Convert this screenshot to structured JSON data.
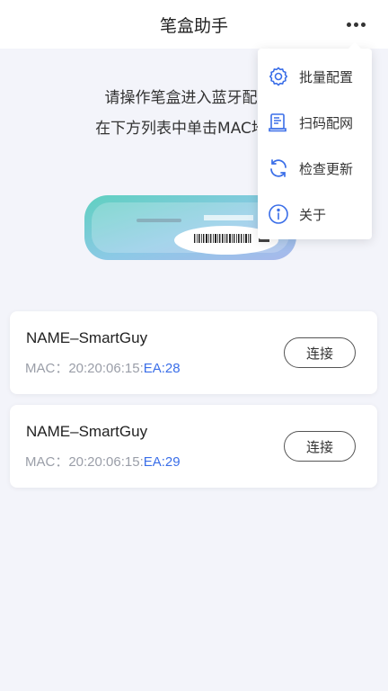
{
  "header": {
    "title": "笔盒助手"
  },
  "instructions": {
    "line1": "请操作笔盒进入蓝牙配对",
    "line2": "在下方列表中单击MAC地址"
  },
  "menu": {
    "items": [
      {
        "label": "批量配置",
        "icon": "batch-config-gear-icon"
      },
      {
        "label": "扫码配网",
        "icon": "scan-code-icon"
      },
      {
        "label": "检查更新",
        "icon": "refresh-icon"
      },
      {
        "label": "关于",
        "icon": "info-icon"
      }
    ]
  },
  "devices": [
    {
      "name": "NAME–SmartGuy",
      "mac_prefix": "MAC：20:20:06:15:",
      "mac_suffix": "EA:28",
      "action": "连接"
    },
    {
      "name": "NAME–SmartGuy",
      "mac_prefix": "MAC：20:20:06:15:",
      "mac_suffix": "EA:29",
      "action": "连接"
    }
  ],
  "colors": {
    "accent": "#3a6ee8",
    "background": "#f3f4fa",
    "device_teal": "#6fd6c8"
  }
}
